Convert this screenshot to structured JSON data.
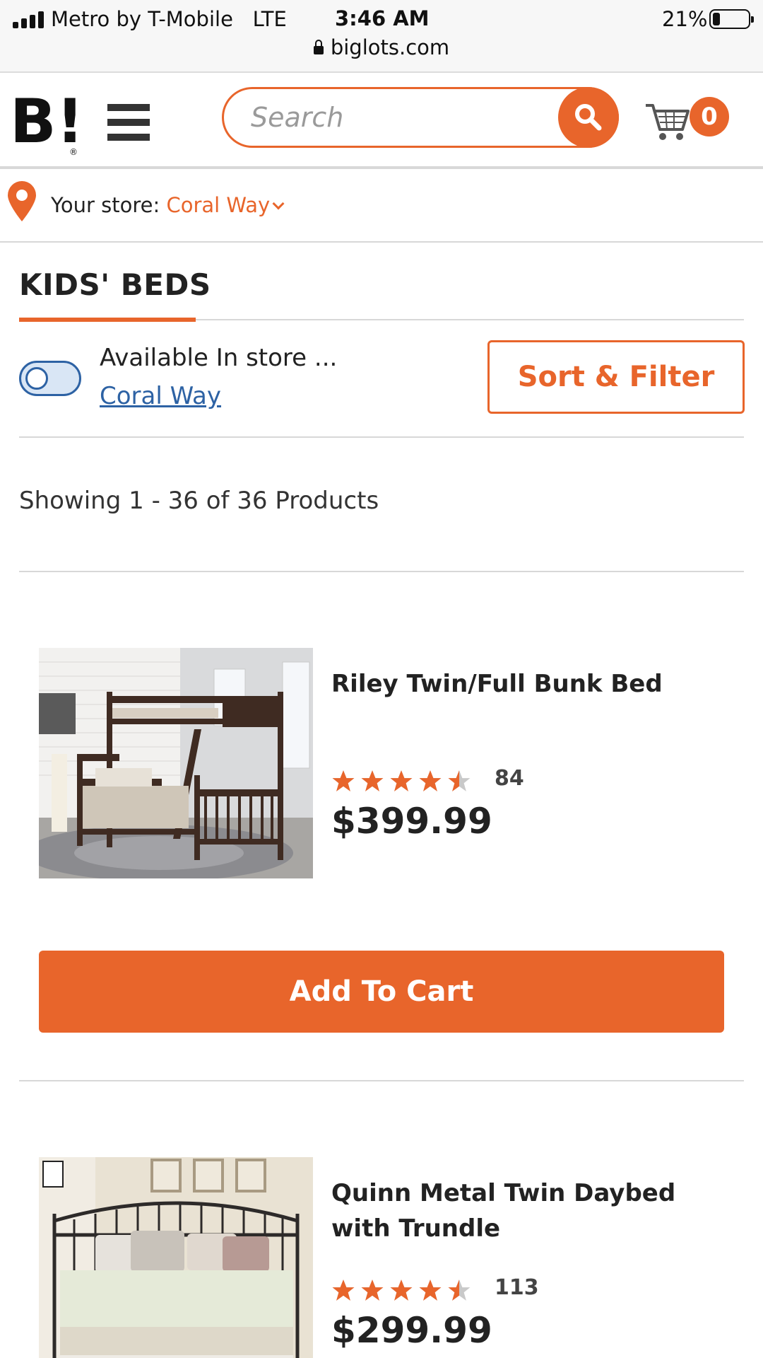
{
  "status_bar": {
    "carrier": "Metro by T-Mobile",
    "network": "LTE",
    "time": "3:46 AM",
    "battery_percent": "21%",
    "battery_level": 0.21,
    "url": "biglots.com"
  },
  "header": {
    "logo_text": "B!",
    "search_placeholder": "Search",
    "cart_count": "0"
  },
  "store": {
    "label": "Your store:",
    "name": "Coral Way"
  },
  "category": {
    "title": "KIDS' BEDS",
    "availability_label": "Available In store ...",
    "availability_store": "Coral Way",
    "toggle_on": false,
    "sort_filter_label": "Sort & Filter",
    "results_text": "Showing 1 - 36 of 36 Products"
  },
  "products": [
    {
      "title": "Riley Twin/Full Bunk Bed",
      "rating": 4.5,
      "review_count": "84",
      "price": "$399.99",
      "add_to_cart_label": "Add To Cart"
    },
    {
      "title": "Quinn Metal Twin Daybed with Trundle",
      "rating": 4.5,
      "review_count": "113",
      "price": "$299.99"
    }
  ],
  "colors": {
    "brand_orange": "#e8652b",
    "link_blue": "#2d62a4"
  },
  "icons": [
    "signal-icon",
    "lock-icon",
    "battery-icon",
    "menu-icon",
    "search-icon",
    "cart-icon",
    "location-pin-icon",
    "chevron-down-icon",
    "star-icon"
  ]
}
